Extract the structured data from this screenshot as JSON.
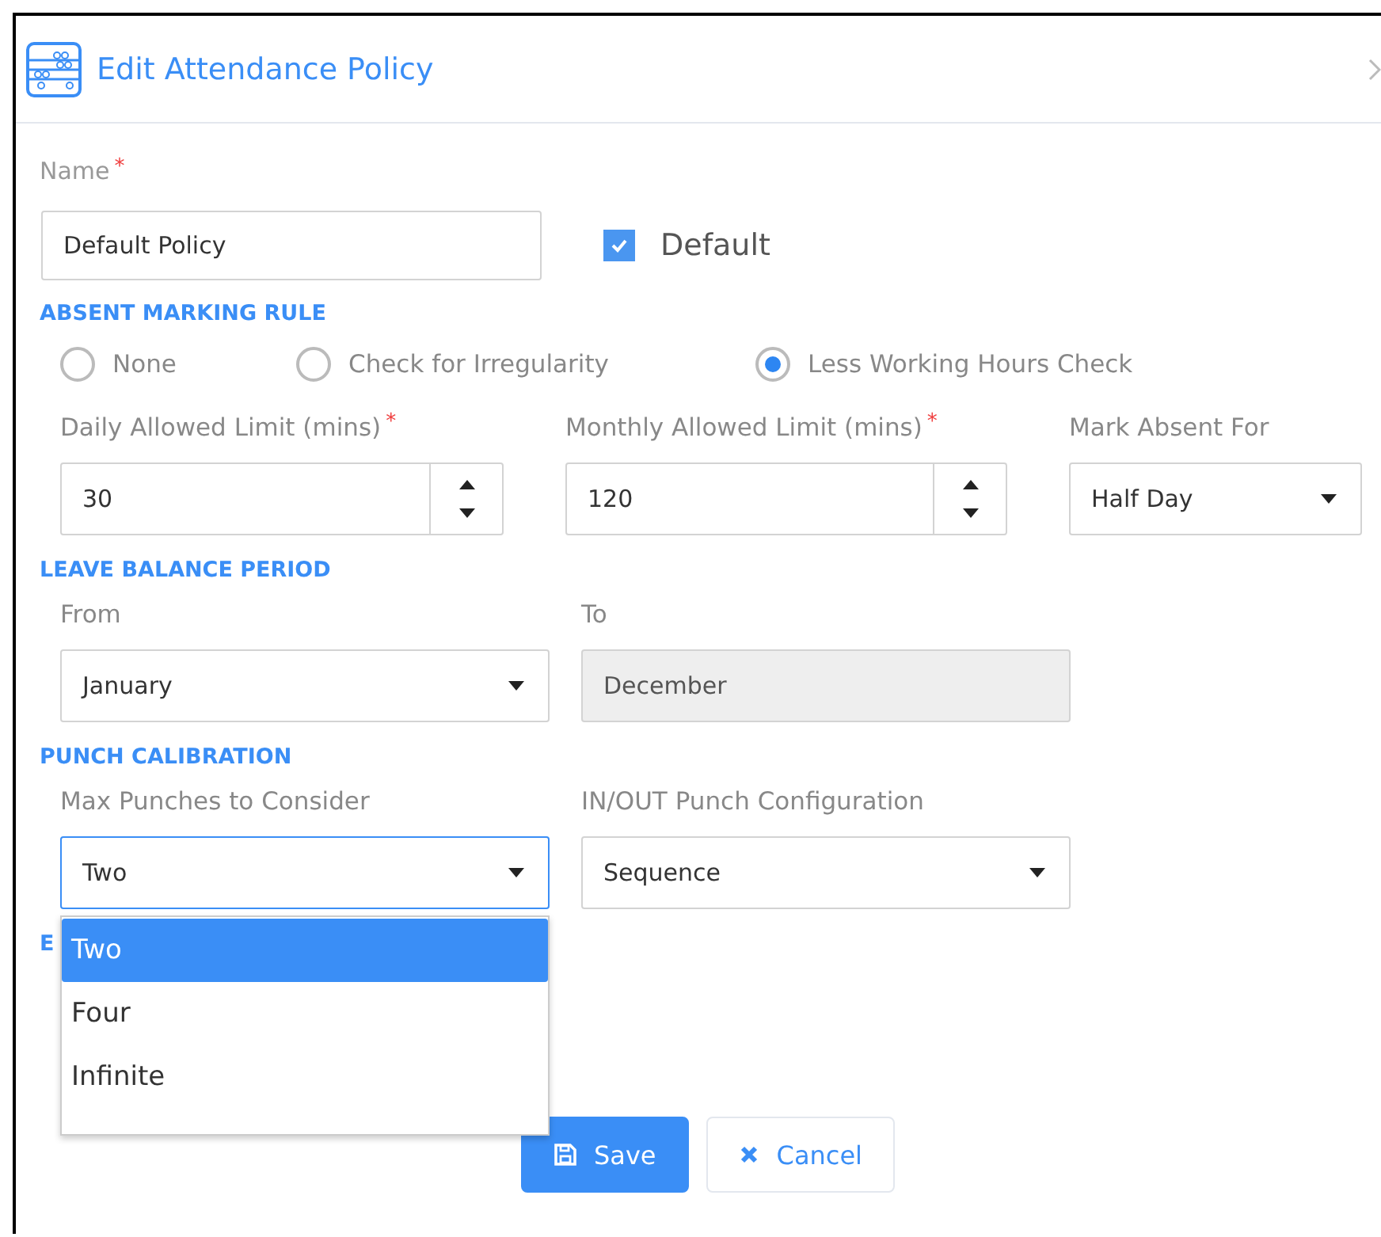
{
  "dialog": {
    "title": "Edit Attendance Policy"
  },
  "name_field": {
    "label": "Name",
    "required_mark": "*",
    "value": "Default Policy"
  },
  "default_checkbox": {
    "label": "Default",
    "checked": true
  },
  "sections": [
    {
      "heading": "ABSENT MARKING RULE",
      "options": [
        {
          "label": "None",
          "selected": false
        },
        {
          "label": "Check for Irregularity",
          "selected": false
        },
        {
          "label": "Less Working Hours Check",
          "selected": true
        }
      ],
      "fields": [
        {
          "kind": "number",
          "label": "Daily Allowed Limit (mins)",
          "required_mark": "*",
          "value": "30"
        },
        {
          "kind": "number",
          "label": "Monthly Allowed Limit (mins)",
          "required_mark": "*",
          "value": "120"
        },
        {
          "kind": "select",
          "label": "Mark Absent For",
          "value": "Half Day"
        }
      ]
    },
    {
      "heading": "LEAVE BALANCE PERIOD",
      "fields": [
        {
          "kind": "select",
          "label": "From",
          "value": "January",
          "disabled": false
        },
        {
          "kind": "select",
          "label": "To",
          "value": "December",
          "disabled": true
        }
      ]
    },
    {
      "heading": "PUNCH CALIBRATION",
      "fields": [
        {
          "kind": "select",
          "label": "Max Punches to Consider",
          "value": "Two",
          "focused": true,
          "options": [
            {
              "label": "Two",
              "selected": true
            },
            {
              "label": "Four",
              "selected": false
            },
            {
              "label": "Infinite",
              "selected": false
            }
          ]
        },
        {
          "kind": "select",
          "label": "IN/OUT Punch Configuration",
          "value": "Sequence"
        }
      ]
    },
    {
      "heading": "E"
    }
  ],
  "buttons": [
    {
      "kind": "primary",
      "label": "Save"
    },
    {
      "kind": "secondary",
      "label": "Cancel"
    }
  ]
}
